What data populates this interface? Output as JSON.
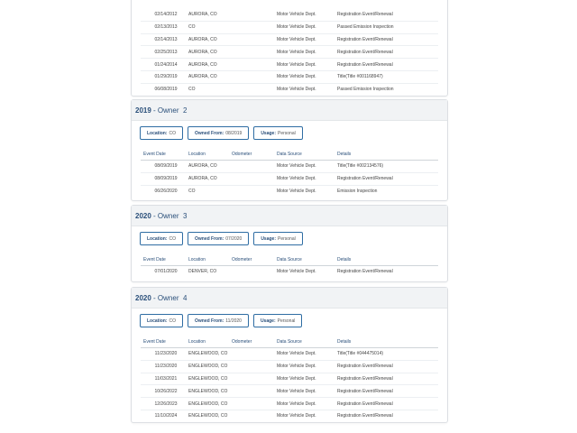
{
  "headers": [
    "Event Date",
    "Location",
    "Odometer",
    "Data Source",
    "Details"
  ],
  "labels": {
    "location": "Location:",
    "owned_from": "Owned From:",
    "usage": "Usage:"
  },
  "owner1_tail": {
    "rows": [
      [
        "02/14/2012",
        "AURORA, CO",
        "",
        "Motor Vehicle Dept.",
        "Registration Event/Renewal"
      ],
      [
        "02/13/2013",
        "CO",
        "",
        "Motor Vehicle Dept.",
        "Passed Emission Inspection"
      ],
      [
        "02/14/2013",
        "AURORA, CO",
        "",
        "Motor Vehicle Dept.",
        "Registration Event/Renewal"
      ],
      [
        "02/25/2013",
        "AURORA, CO",
        "",
        "Motor Vehicle Dept.",
        "Registration Event/Renewal"
      ],
      [
        "01/24/2014",
        "AURORA, CO",
        "",
        "Motor Vehicle Dept.",
        "Registration Event/Renewal"
      ],
      [
        "01/29/2019",
        "AURORA, CO",
        "",
        "Motor Vehicle Dept.",
        "Title(Title #001168947)"
      ],
      [
        "06/08/2019",
        "CO",
        "",
        "Motor Vehicle Dept.",
        "Passed Emission Inspection"
      ]
    ]
  },
  "owners": [
    {
      "year": "2019",
      "owner_label": "- Owner",
      "number": "2",
      "location": "CO",
      "owned_from": "08/2019",
      "usage": "Personal",
      "rows": [
        [
          "08/09/2019",
          "AURORA, CO",
          "",
          "Motor Vehicle Dept.",
          "Title(Title #002134576)"
        ],
        [
          "08/09/2019",
          "AURORA, CO",
          "",
          "Motor Vehicle Dept.",
          "Registration Event/Renewal"
        ],
        [
          "06/26/2020",
          "CO",
          "",
          "Motor Vehicle Dept.",
          "Emission Inspection"
        ]
      ]
    },
    {
      "year": "2020",
      "owner_label": "- Owner",
      "number": "3",
      "location": "CO",
      "owned_from": "07/2020",
      "usage": "Personal",
      "rows": [
        [
          "07/01/2020",
          "DENVER, CO",
          "",
          "Motor Vehicle Dept.",
          "Registration Event/Renewal"
        ]
      ]
    },
    {
      "year": "2020",
      "owner_label": "- Owner",
      "number": "4",
      "location": "CO",
      "owned_from": "11/2020",
      "usage": "Personal",
      "rows": [
        [
          "11/23/2020",
          "ENGLEWOOD, CO",
          "",
          "Motor Vehicle Dept.",
          "Title(Title #044475014)"
        ],
        [
          "11/23/2020",
          "ENGLEWOOD, CO",
          "",
          "Motor Vehicle Dept.",
          "Registration Event/Renewal"
        ],
        [
          "11/03/2021",
          "ENGLEWOOD, CO",
          "",
          "Motor Vehicle Dept.",
          "Registration Event/Renewal"
        ],
        [
          "10/26/2022",
          "ENGLEWOOD, CO",
          "",
          "Motor Vehicle Dept.",
          "Registration Event/Renewal"
        ],
        [
          "12/26/2023",
          "ENGLEWOOD, CO",
          "",
          "Motor Vehicle Dept.",
          "Registration Event/Renewal"
        ],
        [
          "11/10/2024",
          "ENGLEWOOD, CO",
          "",
          "Motor Vehicle Dept.",
          "Registration Event/Renewal"
        ]
      ]
    }
  ]
}
